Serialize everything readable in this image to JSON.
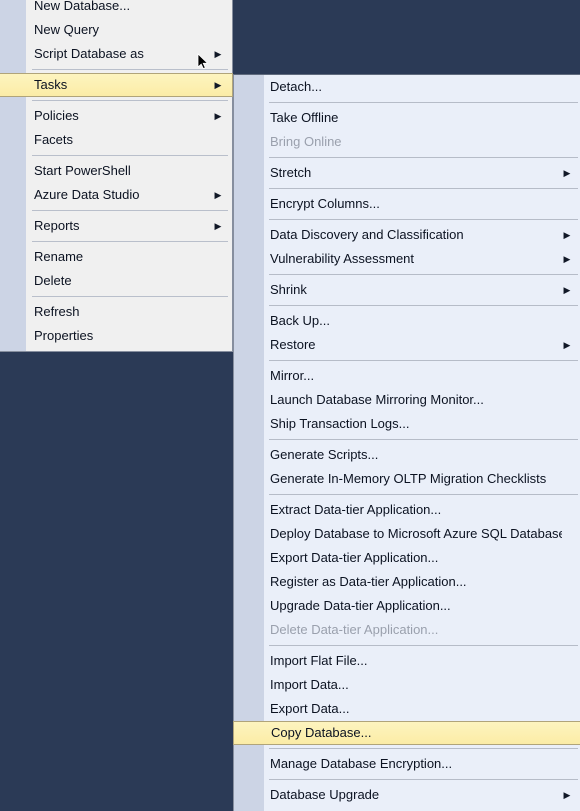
{
  "theme": {
    "desktop_bg": "#2b3a56",
    "menu_bg": "#f0f0f0",
    "submenu_bg": "#eaeff9",
    "gutter": "#ccd4e5",
    "highlight_fill": "#fbeca6",
    "highlight_border": "#b0a47a",
    "text": "#0b1221",
    "disabled_text": "#9aa0ad",
    "separator": "#b6bcc8"
  },
  "icons": {
    "submenu_arrow": "▶",
    "cursor": "mouse-pointer-icon"
  },
  "context_menu": {
    "name": "database-context-menu",
    "groups": [
      {
        "items": [
          {
            "label": "New Database...",
            "arrow": false,
            "disabled": false,
            "selected": false
          },
          {
            "label": "New Query",
            "arrow": false,
            "disabled": false,
            "selected": false
          },
          {
            "label": "Script Database as",
            "arrow": true,
            "disabled": false,
            "selected": false
          }
        ]
      },
      {
        "items": [
          {
            "label": "Tasks",
            "arrow": true,
            "disabled": false,
            "selected": true
          }
        ]
      },
      {
        "items": [
          {
            "label": "Policies",
            "arrow": true,
            "disabled": false,
            "selected": false
          },
          {
            "label": "Facets",
            "arrow": false,
            "disabled": false,
            "selected": false
          }
        ]
      },
      {
        "items": [
          {
            "label": "Start PowerShell",
            "arrow": false,
            "disabled": false,
            "selected": false
          },
          {
            "label": "Azure Data Studio",
            "arrow": true,
            "disabled": false,
            "selected": false
          }
        ]
      },
      {
        "items": [
          {
            "label": "Reports",
            "arrow": true,
            "disabled": false,
            "selected": false
          }
        ]
      },
      {
        "items": [
          {
            "label": "Rename",
            "arrow": false,
            "disabled": false,
            "selected": false
          },
          {
            "label": "Delete",
            "arrow": false,
            "disabled": false,
            "selected": false
          }
        ]
      },
      {
        "items": [
          {
            "label": "Refresh",
            "arrow": false,
            "disabled": false,
            "selected": false
          },
          {
            "label": "Properties",
            "arrow": false,
            "disabled": false,
            "selected": false
          }
        ]
      }
    ]
  },
  "tasks_submenu": {
    "name": "tasks-submenu",
    "groups": [
      {
        "items": [
          {
            "label": "Detach...",
            "arrow": false,
            "disabled": false,
            "selected": false
          }
        ]
      },
      {
        "items": [
          {
            "label": "Take Offline",
            "arrow": false,
            "disabled": false,
            "selected": false
          },
          {
            "label": "Bring Online",
            "arrow": false,
            "disabled": true,
            "selected": false
          }
        ]
      },
      {
        "items": [
          {
            "label": "Stretch",
            "arrow": true,
            "disabled": false,
            "selected": false
          }
        ]
      },
      {
        "items": [
          {
            "label": "Encrypt Columns...",
            "arrow": false,
            "disabled": false,
            "selected": false
          }
        ]
      },
      {
        "items": [
          {
            "label": "Data Discovery and Classification",
            "arrow": true,
            "disabled": false,
            "selected": false
          },
          {
            "label": "Vulnerability Assessment",
            "arrow": true,
            "disabled": false,
            "selected": false
          }
        ]
      },
      {
        "items": [
          {
            "label": "Shrink",
            "arrow": true,
            "disabled": false,
            "selected": false
          }
        ]
      },
      {
        "items": [
          {
            "label": "Back Up...",
            "arrow": false,
            "disabled": false,
            "selected": false
          },
          {
            "label": "Restore",
            "arrow": true,
            "disabled": false,
            "selected": false
          }
        ]
      },
      {
        "items": [
          {
            "label": "Mirror...",
            "arrow": false,
            "disabled": false,
            "selected": false
          },
          {
            "label": "Launch Database Mirroring Monitor...",
            "arrow": false,
            "disabled": false,
            "selected": false
          },
          {
            "label": "Ship Transaction Logs...",
            "arrow": false,
            "disabled": false,
            "selected": false
          }
        ]
      },
      {
        "items": [
          {
            "label": "Generate Scripts...",
            "arrow": false,
            "disabled": false,
            "selected": false
          },
          {
            "label": "Generate In-Memory OLTP Migration Checklists",
            "arrow": false,
            "disabled": false,
            "selected": false
          }
        ]
      },
      {
        "items": [
          {
            "label": "Extract Data-tier Application...",
            "arrow": false,
            "disabled": false,
            "selected": false
          },
          {
            "label": "Deploy Database to Microsoft Azure SQL Database...",
            "arrow": false,
            "disabled": false,
            "selected": false
          },
          {
            "label": "Export Data-tier Application...",
            "arrow": false,
            "disabled": false,
            "selected": false
          },
          {
            "label": "Register as Data-tier Application...",
            "arrow": false,
            "disabled": false,
            "selected": false
          },
          {
            "label": "Upgrade Data-tier Application...",
            "arrow": false,
            "disabled": false,
            "selected": false
          },
          {
            "label": "Delete Data-tier Application...",
            "arrow": false,
            "disabled": true,
            "selected": false
          }
        ]
      },
      {
        "items": [
          {
            "label": "Import Flat File...",
            "arrow": false,
            "disabled": false,
            "selected": false
          },
          {
            "label": "Import Data...",
            "arrow": false,
            "disabled": false,
            "selected": false
          },
          {
            "label": "Export Data...",
            "arrow": false,
            "disabled": false,
            "selected": false
          },
          {
            "label": "Copy Database...",
            "arrow": false,
            "disabled": false,
            "selected": true
          }
        ]
      },
      {
        "items": [
          {
            "label": "Manage Database Encryption...",
            "arrow": false,
            "disabled": false,
            "selected": false
          }
        ]
      },
      {
        "items": [
          {
            "label": "Database Upgrade",
            "arrow": true,
            "disabled": false,
            "selected": false
          }
        ]
      }
    ]
  }
}
